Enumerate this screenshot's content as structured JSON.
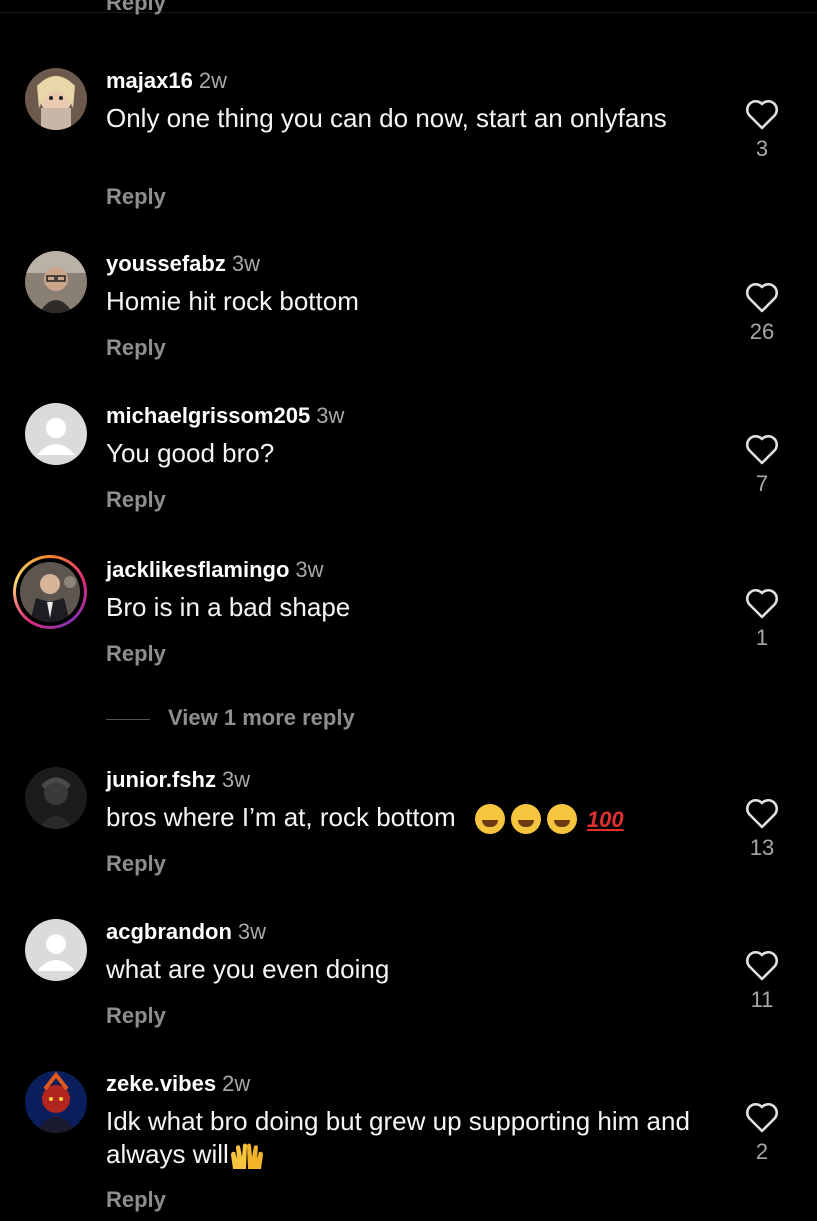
{
  "top_reply_label": "Reply",
  "comments": [
    {
      "username": "majax16",
      "time": "2w",
      "text": "Only one thing you can do now, start an onlyfans",
      "reply_label": "Reply",
      "likes": "3"
    },
    {
      "username": "youssefabz",
      "time": "3w",
      "text": "Homie hit rock bottom",
      "reply_label": "Reply",
      "likes": "26"
    },
    {
      "username": "michaelgrissom205",
      "time": "3w",
      "text": "You good bro?",
      "reply_label": "Reply",
      "likes": "7"
    },
    {
      "username": "jacklikesflamingo",
      "time": "3w",
      "text": "Bro is in a bad shape",
      "reply_label": "Reply",
      "likes": "1"
    },
    {
      "username": "junior.fshz",
      "time": "3w",
      "text": "bros where I’m at, rock bottom",
      "reply_label": "Reply",
      "likes": "13"
    },
    {
      "username": "acgbrandon",
      "time": "3w",
      "text": "what are you even doing",
      "reply_label": "Reply",
      "likes": "11"
    },
    {
      "username": "zeke.vibes",
      "time": "2w",
      "text": "Idk what bro doing but grew up supporting him and always will",
      "reply_label": "Reply",
      "likes": "2"
    }
  ],
  "view_more_replies": "View 1 more reply",
  "colors": {
    "background": "#000000",
    "secondary_text": "#8e8e8e",
    "story_ring": "#dd2a7b"
  },
  "icons": {
    "like": "heart-outline-icon",
    "default_avatar": "user-silhouette-icon"
  }
}
